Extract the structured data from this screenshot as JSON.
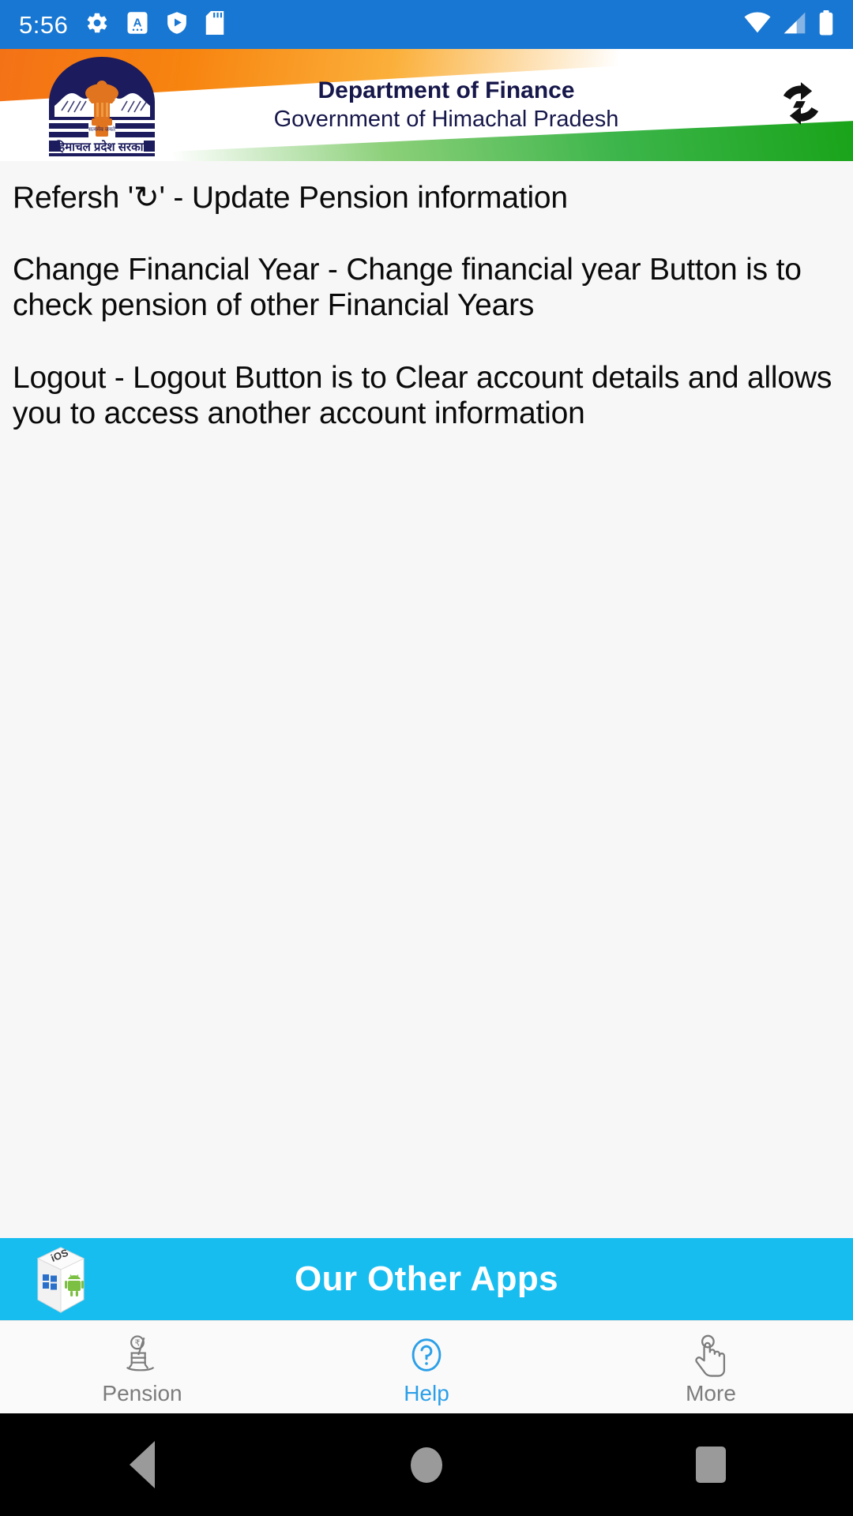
{
  "status_bar": {
    "time": "5:56",
    "left_icons": [
      "gear-icon",
      "translate-a-icon",
      "play-protect-shield-icon",
      "sd-card-icon"
    ],
    "right_icons": [
      "wifi-icon",
      "cellular-signal-icon",
      "battery-icon"
    ],
    "background_color": "#1877d2"
  },
  "header": {
    "title_line1": "Department of Finance",
    "title_line2": "Government of Himachal Pradesh",
    "emblem_alt": "himachal-pradesh-government-emblem",
    "emblem_caption": "हिमाचल प्रदेश सरकार",
    "refresh_icon": "refresh-sync-icon",
    "title_color": "#16174a",
    "saffron_color": "#f7840f",
    "green_color": "#3cb54a"
  },
  "content": {
    "paragraphs": [
      "Refersh '↻' - Update Pension information",
      "Change Financial Year - Change financial year Button is to check pension of other Financial Years",
      "Logout  - Logout Button is to Clear account details and allows you to access another account information"
    ],
    "background_color": "#f7f7f7"
  },
  "other_apps_banner": {
    "label": "Our Other Apps",
    "icon": "os-cube-icon",
    "background_color": "#18bdf0",
    "text_color": "#ffffff"
  },
  "bottom_tabs": {
    "active_color": "#2b9fe8",
    "inactive_color": "#7c7c7c",
    "items": [
      {
        "label": "Pension",
        "icon": "rupee-rocking-chair-icon",
        "active": false
      },
      {
        "label": "Help",
        "icon": "question-circle-icon",
        "active": true
      },
      {
        "label": "More",
        "icon": "hand-tap-icon",
        "active": false
      }
    ]
  },
  "android_nav": {
    "buttons": [
      "back-triangle-icon",
      "home-circle-icon",
      "recents-square-icon"
    ],
    "background_color": "#000000"
  }
}
